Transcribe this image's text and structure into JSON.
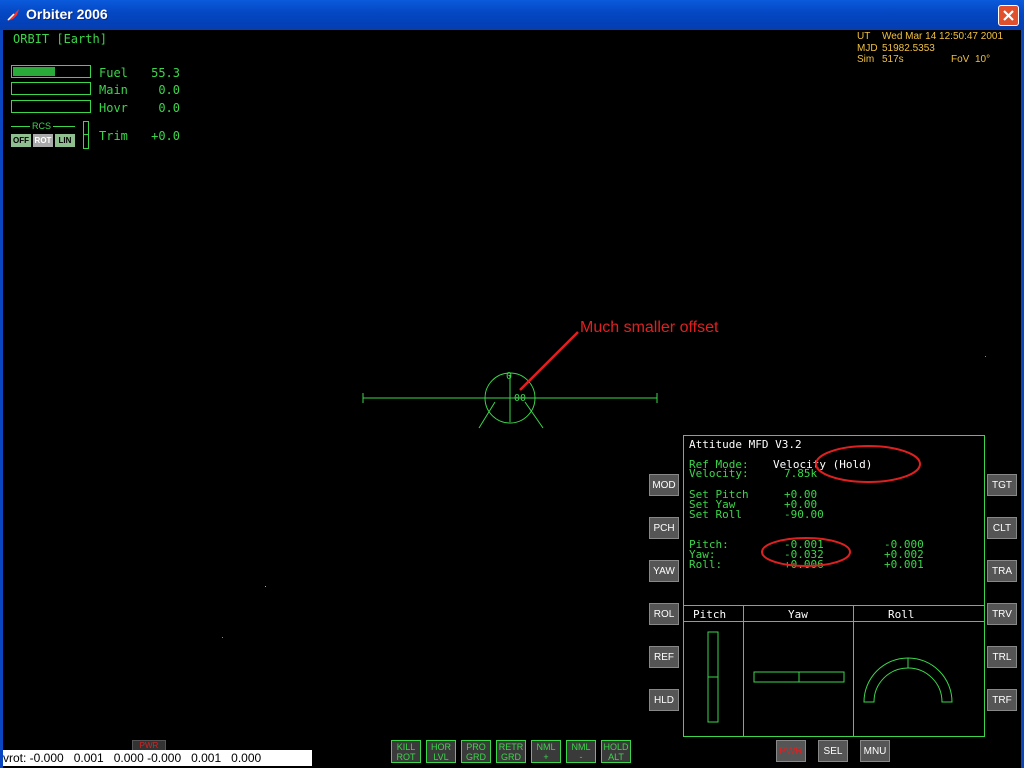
{
  "window": {
    "title": "Orbiter 2006"
  },
  "hud": {
    "mode": "ORBIT [Earth]",
    "gauges": [
      {
        "label": "Fuel",
        "value": "55.3",
        "fill": 0.553
      },
      {
        "label": "Main",
        "value": "0.0",
        "fill": 0
      },
      {
        "label": "Hovr",
        "value": "0.0",
        "fill": 0
      }
    ],
    "rcs": {
      "label": "RCS",
      "buttons": [
        "OFF",
        "ROT",
        "LIN"
      ],
      "active": "ROT"
    },
    "trim": {
      "label": "Trim",
      "value": "+0.0"
    },
    "pitch_ladder_label": "0",
    "pitch_ladder_marker": "-00"
  },
  "info": {
    "ut_label": "UT",
    "ut_value": "Wed Mar 14 12:50:47 2001",
    "mjd_label": "MJD",
    "mjd_value": "51982.5353",
    "sim_label": "Sim",
    "sim_value": "517s",
    "fov_label": "FoV",
    "fov_value": "10°"
  },
  "annotation": {
    "text": "Much smaller offset",
    "color": "#e02020"
  },
  "mfd": {
    "title": "Attitude MFD V3.2",
    "ref_mode_label": "Ref Mode:",
    "ref_mode_value": "Velocity (Hold)",
    "velocity_label": "Velocity:",
    "velocity_value": "7.85k",
    "set_pitch_label": "Set Pitch",
    "set_pitch_value": "+0.00",
    "set_yaw_label": "Set Yaw",
    "set_yaw_value": "+0.00",
    "set_roll_label": "Set Roll",
    "set_roll_value": "-90.00",
    "pitch_label": "Pitch:",
    "pitch_value": "-0.001",
    "pitch_rate": "-0.000",
    "yaw_label": "Yaw:",
    "yaw_value": "-0.032",
    "yaw_rate": "+0.002",
    "roll_label": "Roll:",
    "roll_value": "+0.006",
    "roll_rate": "+0.001",
    "col_pitch": "Pitch",
    "col_yaw": "Yaw",
    "col_roll": "Roll",
    "left_buttons": [
      "MOD",
      "PCH",
      "YAW",
      "ROL",
      "REF",
      "HLD"
    ],
    "right_buttons": [
      "TGT",
      "CLT",
      "TRA",
      "TRV",
      "TRL",
      "TRF"
    ],
    "bottom_buttons": [
      "PWR",
      "SEL",
      "MNU"
    ]
  },
  "nav_buttons": [
    [
      "KILL",
      "ROT"
    ],
    [
      "HOR",
      "LVL"
    ],
    [
      "PRO",
      "GRD"
    ],
    [
      "RETR",
      "GRD"
    ],
    [
      "NML",
      "+"
    ],
    [
      "NML",
      "-"
    ],
    [
      "HOLD",
      "ALT"
    ]
  ],
  "statusbar": {
    "text": "vrot: -0.000   0.001   0.000 -0.000   0.001   0.000"
  },
  "small_pwr": "PWR",
  "colors": {
    "hud_green": "#3bd64a",
    "info_yellow": "#f0c040",
    "annotation_red": "#e02020"
  }
}
